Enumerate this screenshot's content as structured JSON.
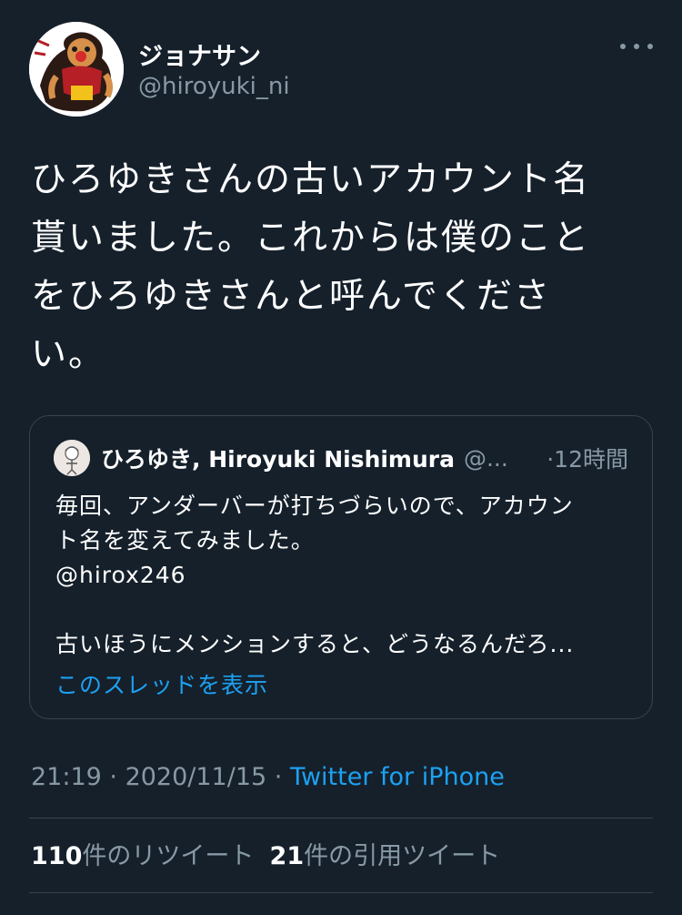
{
  "author": {
    "display_name": "ジョナサン",
    "handle": "@hiroyuki_ni"
  },
  "icons": {
    "more": "more-horizontal-icon",
    "avatar": "user-avatar",
    "quote_avatar": "quoted-user-avatar"
  },
  "tweet": {
    "text": "ひろゆきさんの古いアカウント名\n貰いました。これからは僕のこと\nをひろゆきさんと呼んでくださ\nい。"
  },
  "quoted": {
    "name": "ひろゆき, Hiroyuki Nishimura",
    "handle": "@...",
    "time": "·12時間",
    "text": "毎回、アンダーバーが打ちづらいので、アカウン\nト名を変えてみました。\n@hirox246\n\n古いほうにメンションすると、どうなるんだろ...",
    "show_thread": "このスレッドを表示"
  },
  "meta": {
    "time": "21:19",
    "date": "2020/11/15",
    "separator": " · ",
    "source": "Twitter for iPhone"
  },
  "stats": {
    "retweets_count": "110",
    "retweets_label": "件のリツイート",
    "quotes_count": "21",
    "quotes_label": "件の引用ツイート"
  },
  "colors": {
    "background": "#15202b",
    "secondary_text": "#8899a6",
    "link": "#1da1f2",
    "border": "#38444d"
  }
}
